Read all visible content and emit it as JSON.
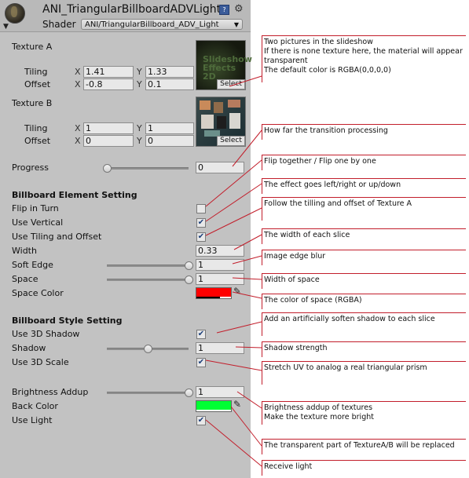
{
  "header": {
    "title": "ANI_TriangularBillboardADVLight",
    "shader_label": "Shader",
    "shader_value": "ANI/TriangularBillboard_ADV_Light"
  },
  "textureA": {
    "label": "Texture A",
    "tiling_label": "Tiling",
    "offset_label": "Offset",
    "tiling_x": "1.41",
    "tiling_y": "1.33",
    "offset_x": "-0.8",
    "offset_y": "0.1",
    "thumb_text": "Slideshow Effects 2D",
    "select_label": "Select"
  },
  "textureB": {
    "label": "Texture B",
    "tiling_label": "Tiling",
    "offset_label": "Offset",
    "tiling_x": "1",
    "tiling_y": "1",
    "offset_x": "0",
    "offset_y": "0",
    "select_label": "Select"
  },
  "axis": {
    "x": "X",
    "y": "Y"
  },
  "progress": {
    "label": "Progress",
    "value": "0",
    "level": 0
  },
  "billboard_element": {
    "heading": "Billboard Element Setting",
    "flip_label": "Flip in Turn",
    "flip_checked": false,
    "vertical_label": "Use Vertical",
    "vertical_checked": true,
    "tiling_offset_label": "Use Tiling and Offset",
    "tiling_offset_checked": true,
    "width_label": "Width",
    "width_value": "0.33",
    "soft_edge_label": "Soft Edge",
    "soft_edge_value": "1",
    "soft_edge_level": 1,
    "space_label": "Space",
    "space_value": "1",
    "space_level": 1,
    "space_color_label": "Space Color",
    "space_color": "#ff0000"
  },
  "billboard_style": {
    "heading": "Billboard Style Setting",
    "shadow3d_label": "Use 3D Shadow",
    "shadow3d_checked": true,
    "shadow_label": "Shadow",
    "shadow_value": "1",
    "shadow_level": 0.5,
    "scale3d_label": "Use 3D Scale",
    "scale3d_checked": true
  },
  "misc": {
    "brightness_label": "Brightness Addup",
    "brightness_value": "1",
    "brightness_level": 1,
    "back_color_label": "Back Color",
    "back_color": "#00ff33",
    "use_light_label": "Use Light",
    "use_light_checked": true
  },
  "notes": {
    "n1": "Two pictures in the slideshow\nIf there is none texture here, the material will appear transparent\nThe default color is RGBA(0,0,0,0)",
    "n2": "How far the transition processing",
    "n3": "Flip together / Flip one by one",
    "n4": "The effect goes left/right or up/down",
    "n5": "Follow the tilling and offset of Texture A",
    "n6": "The width of each slice",
    "n7": "Image edge blur",
    "n8": "Width of space",
    "n9": "The color of space (RGBA)",
    "n10": "Add an artificially soften shadow to each slice",
    "n11": "Shadow strength",
    "n12": "Stretch UV to analog a real triangular prism",
    "n13": "Brightness addup of textures\nMake the texture more bright",
    "n14": "The transparent part of TextureA/B will be replaced",
    "n15": "Receive light"
  },
  "colors": {
    "accent_line": "#c21e2b",
    "panel_bg": "#c2c2c2"
  }
}
